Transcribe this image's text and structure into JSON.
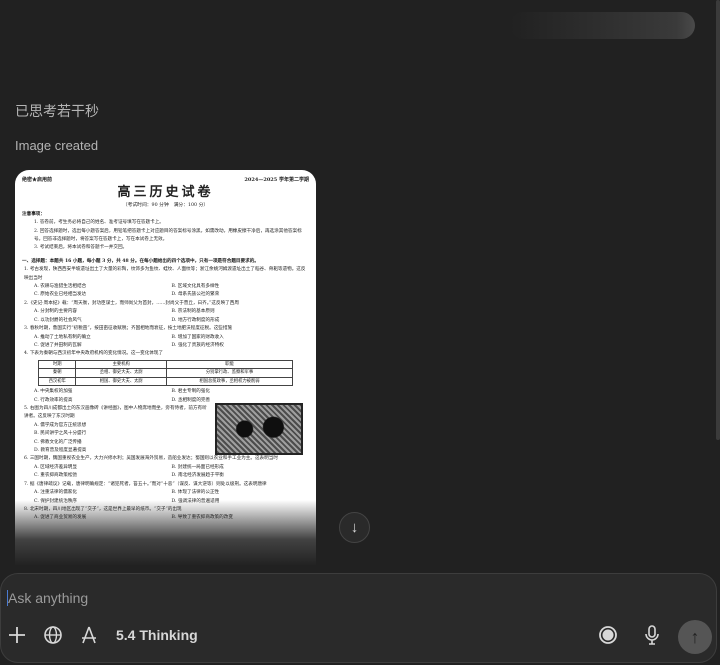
{
  "thought_label": "已思考若干秒",
  "status": "Image created",
  "doc": {
    "secret": "绝密★启用前",
    "term": "2024—2025 学年第二学期",
    "title": "高三历史试卷",
    "subtitle": "（考试时间：90 分钟　满分：100 分）",
    "notes_heading": "注意事项：",
    "notes": [
      "1. 答卷前，考生务必将自己的姓名、准考证号填写在答题卡上。",
      "2. 回答选择题时，选出每小题答案后，用铅笔把答题卡上对应题目的答案标号涂黑，如需改动，用橡皮擦干净后，再选涂其他答案标号。回答非选择题时，将答案写在答题卡上，写在本试卷上无效。",
      "3. 考试结束后，将本试卷和答题卡一并交回。"
    ],
    "section": "一、选择题：本题共 16 小题，每小题 3 分，共 48 分。在每小题给出的四个选项中，只有一项是符合题目要求的。",
    "questions": [
      {
        "stem": "1. 考古发现，陕西西安半坡遗址出土了大量的彩陶，纹饰多为鱼纹、蛙纹、人面纹等；浙江余姚河姆渡遗址出土了稻谷、骨耜等遗物。这反映出当时",
        "options": [
          "A. 农耕与渔猎生活相结合",
          "B. 区域文化具有多样性",
          "C. 原始农业已经相当发达",
          "D. 母系氏族公社的繁荣"
        ]
      },
      {
        "stem": "2.《史记·周本纪》载：“周天衡，封功臣谋士，而师尚父为首封，……封尚父于营丘，曰齐。”这反映了西周",
        "options": [
          "A. 分封制的主要内容",
          "B. 宗法制的基本原则",
          "C. 以功封爵的社会风气",
          "D. 地方行政制度的形成"
        ]
      },
      {
        "stem": "3. 春秋时期，鲁国实行“初税亩”，按田亩征收赋税；齐国相地而衰征，按土地肥沃程度征税。这些措施",
        "options": [
          "A. 推动了土地私有制的确立",
          "B. 增加了国家的财政收入",
          "C. 促进了井田制的瓦解",
          "D. 强化了贵族的经济特权"
        ]
      },
      {
        "stem": "4. 下表为秦朝与西汉初年中央政府机构的变化情况。这一变化体现了",
        "options": [
          "A. 中央集权的加强",
          "B. 君主专制的强化",
          "C. 行政效率的提高",
          "D. 丞相制度的完善"
        ]
      },
      {
        "stem": "5. 右图为四川成都出土的东汉画像砖《讲经图》，图中人物席地而坐，旁有侍者，前方有听讲者。这反映了东汉时期",
        "options": [
          "A. 儒学成为官方正统思想",
          "B. 民间讲学之风十分盛行",
          "C. 佛教文化的广泛传播",
          "D. 教育普及程度显著提高"
        ]
      },
      {
        "stem": "6. 三国时期，魏国重视农业生产，大力兴修水利；吴国发展海外贸易，造船业发达；蜀国则以农业和手工业为主。这表明当时",
        "options": [
          "A. 区域经济差异明显",
          "B. 封建统一局面已经形成",
          "C. 重农抑商政策松弛",
          "D. 南北经济发展趋于平衡"
        ]
      },
      {
        "stem": "7. 据《唐律疏议》记载，唐律明确规定：“诸犯死者，笞五十。”而对“十恶”（谋反、谋大逆等）则处以极刑。这表明唐律",
        "options": [
          "A. 注重法律的儒家化",
          "B. 体现了法律的公正性",
          "C. 保护封建统治秩序",
          "D. 强调法律的普遍适用"
        ]
      },
      {
        "stem": "8. 北宋时期，四川地区出现了“交子”，这是世界上最早的纸币。“交子”的出现",
        "options": [
          "A. 促进了商业贸易的发展",
          "B. 导致了重农抑商政策的改变"
        ]
      }
    ],
    "table": {
      "headers": [
        "时期",
        "主要机构",
        "职能"
      ],
      "rows": [
        [
          "秦朝",
          "丞相、御史大夫、太尉",
          "分别掌行政、监察和军事"
        ],
        [
          "西汉初年",
          "相国、御史大夫、太尉",
          "相国总揽政事，丞相权力被削弱"
        ]
      ]
    }
  },
  "composer": {
    "placeholder": "Ask anything",
    "model": "5.4 Thinking"
  }
}
